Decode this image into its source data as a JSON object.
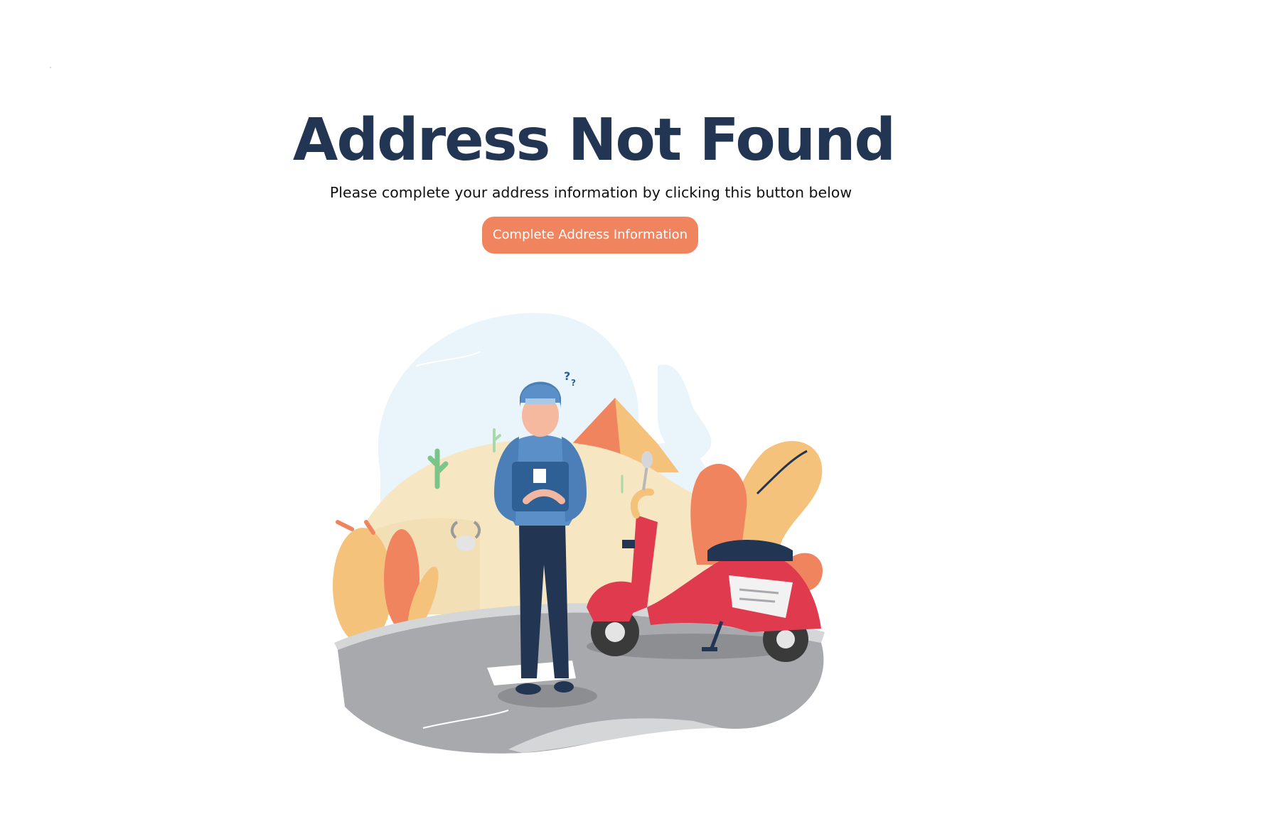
{
  "title": "Address Not Found",
  "subtitle": "Please complete your address information by clicking this button below",
  "cta": {
    "label": "Complete Address Information",
    "color": "#f0845e"
  },
  "illustration": {
    "icon": "lost-delivery-rider-illustration"
  },
  "colors": {
    "heading": "#223553",
    "accent": "#f0845e",
    "scooter": "#e03a4f"
  }
}
